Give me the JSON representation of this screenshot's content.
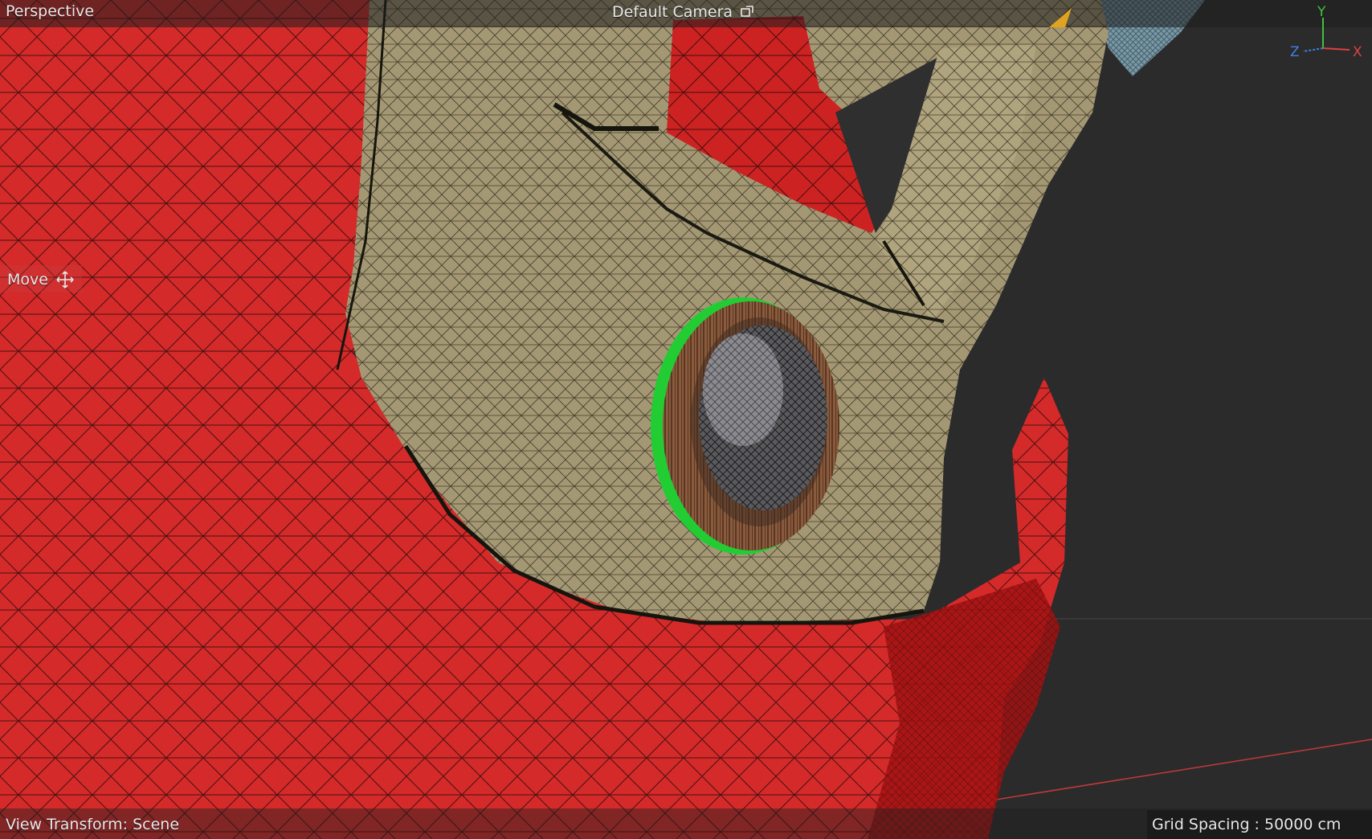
{
  "viewport": {
    "view_name": "Perspective",
    "camera_name": "Default Camera",
    "active_tool": "Move",
    "view_transform": "View Transform: Scene",
    "grid_spacing": "Grid Spacing : 50000 cm"
  },
  "axis_gizmo": {
    "x_label": "X",
    "y_label": "Y",
    "z_label": "Z"
  },
  "icons": {
    "camera": "camera-link-icon",
    "move": "move-arrows-icon",
    "orientation": "view-orientation-marker-icon"
  },
  "colors": {
    "viewport_background": "#2b2b2b",
    "red_body": "#d42a2a",
    "tan_part": "#a49874",
    "wood_ring": "#8a5a3c",
    "selection_green": "#22cc33",
    "axis_x": "#e04040",
    "axis_y": "#40c040",
    "axis_z": "#4080e0",
    "overlay_text": "#e8e8e8"
  }
}
